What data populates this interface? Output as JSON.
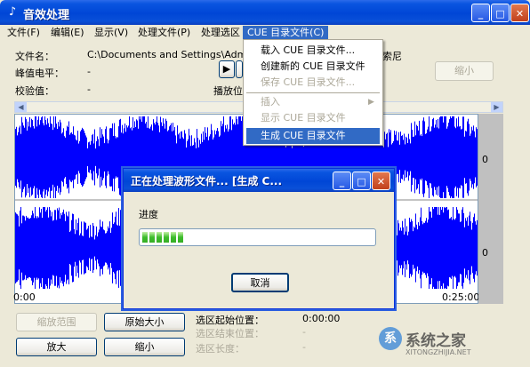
{
  "window": {
    "title": "音效处理",
    "app_icon": "speaker-icon",
    "buttons": [
      "minimize-icon",
      "maximize-icon",
      "close-icon"
    ]
  },
  "menubar": {
    "items": [
      "文件(F)",
      "编辑(E)",
      "显示(V)",
      "处理文件(P)",
      "处理选区",
      "CUE 目录文件(C)"
    ],
    "active_index": 5
  },
  "info": {
    "filename_label": "文件名：",
    "filename_value": "C:\\Documents and Settings\\Administrator",
    "filename_tail": "索尼",
    "peak_label": "峰值电平：",
    "peak_value": "-",
    "checksum_label": "校验值：",
    "checksum_value": "-",
    "position_label": "播放位",
    "shrink_top_label": "缩小"
  },
  "dropdown": {
    "items": [
      {
        "label": "载入 CUE 目录文件...",
        "enabled": true
      },
      {
        "label": "创建新的 CUE 目录文件",
        "enabled": true
      },
      {
        "label": "保存 CUE 目录文件...",
        "enabled": false
      },
      {
        "label": "插入",
        "enabled": false,
        "submenu": true
      },
      {
        "label": "显示 CUE 目录文件",
        "enabled": false
      },
      {
        "label": "生成 CUE 目录文件",
        "enabled": true,
        "selected": true
      }
    ]
  },
  "waveform": {
    "channel_labels": [
      "0",
      "0"
    ],
    "time_start": "0:00",
    "time_end": "0:25:00",
    "color": "#0000FF"
  },
  "dialog": {
    "title": "正在处理波形文件...  [生成 C...",
    "progress_label": "进度",
    "progress_fraction": 0.19,
    "cancel_label": "取消"
  },
  "bottom": {
    "zoom_range_label": "缩放范围",
    "original_size_label": "原始大小",
    "zoom_in_label": "放大",
    "zoom_out_label": "缩小",
    "sel_start_label": "选区起始位置：",
    "sel_start_value": "0:00:00",
    "sel_end_label": "选区结束位置：",
    "sel_end_value": "-",
    "sel_len_label": "选区长度：",
    "sel_len_value": "-"
  },
  "watermark": {
    "text": "系统之家",
    "url_text": "XITONGZHIJIA.NET"
  }
}
